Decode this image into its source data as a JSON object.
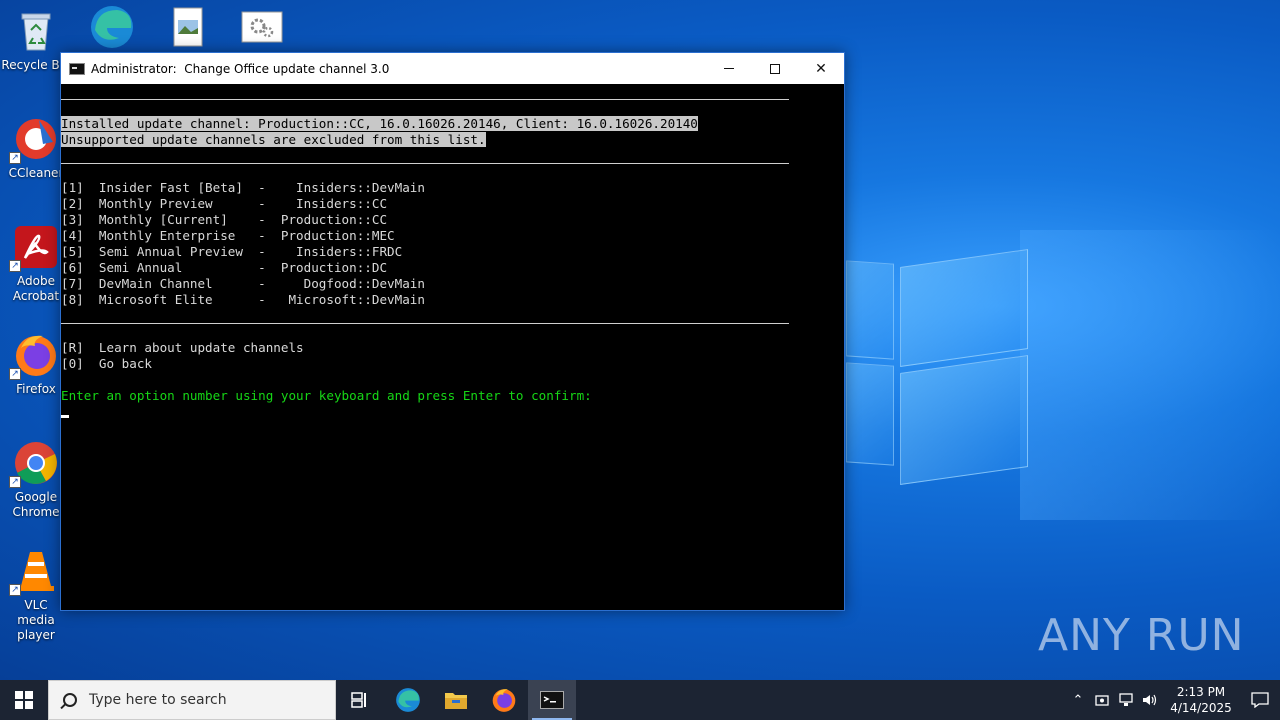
{
  "desktop": {
    "icons": [
      {
        "label": "Recycle Bin",
        "icon": "recycle-bin-icon"
      },
      {
        "label": "CCleaner",
        "icon": "ccleaner-icon"
      },
      {
        "label": "Adobe Acrobat",
        "icon": "adobe-acrobat-icon"
      },
      {
        "label": "Firefox",
        "icon": "firefox-icon"
      },
      {
        "label": "Google Chrome",
        "icon": "chrome-icon"
      },
      {
        "label": "VLC media player",
        "icon": "vlc-icon"
      }
    ],
    "top_icons": [
      "edge-icon",
      "image-file-icon",
      "settings-file-icon"
    ]
  },
  "window": {
    "title": "Administrator:  Change Office update channel 3.0",
    "controls": {
      "minimize": "minimize-icon",
      "maximize": "maximize-icon",
      "close": "close-icon"
    }
  },
  "console": {
    "installed_line": "Installed update channel: Production::CC, 16.0.16026.20146, Client: 16.0.16026.20140",
    "unsupported_line": "Unsupported update channels are excluded from this list.",
    "channels": [
      "[1]  Insider Fast [Beta]  -    Insiders::DevMain",
      "[2]  Monthly Preview      -    Insiders::CC",
      "[3]  Monthly [Current]    -  Production::CC",
      "[4]  Monthly Enterprise   -  Production::MEC",
      "[5]  Semi Annual Preview  -    Insiders::FRDC",
      "[6]  Semi Annual          -  Production::DC",
      "[7]  DevMain Channel      -     Dogfood::DevMain",
      "[8]  Microsoft Elite      -   Microsoft::DevMain"
    ],
    "learn_option": "[R]  Learn about update channels",
    "back_option": "[0]  Go back",
    "prompt": "Enter an option number using your keyboard and press Enter to confirm:"
  },
  "taskbar": {
    "search_placeholder": "Type here to search",
    "pinned": [
      "task-view-icon",
      "edge-icon",
      "file-explorer-icon",
      "firefox-icon",
      "cmd-icon"
    ],
    "time": "2:13 PM",
    "date": "4/14/2025"
  },
  "watermark": "ANY RUN",
  "colors": {
    "prompt_green": "#16d616",
    "highlight_bg": "#c8c8c8",
    "taskbar_bg": "#1c2433"
  }
}
